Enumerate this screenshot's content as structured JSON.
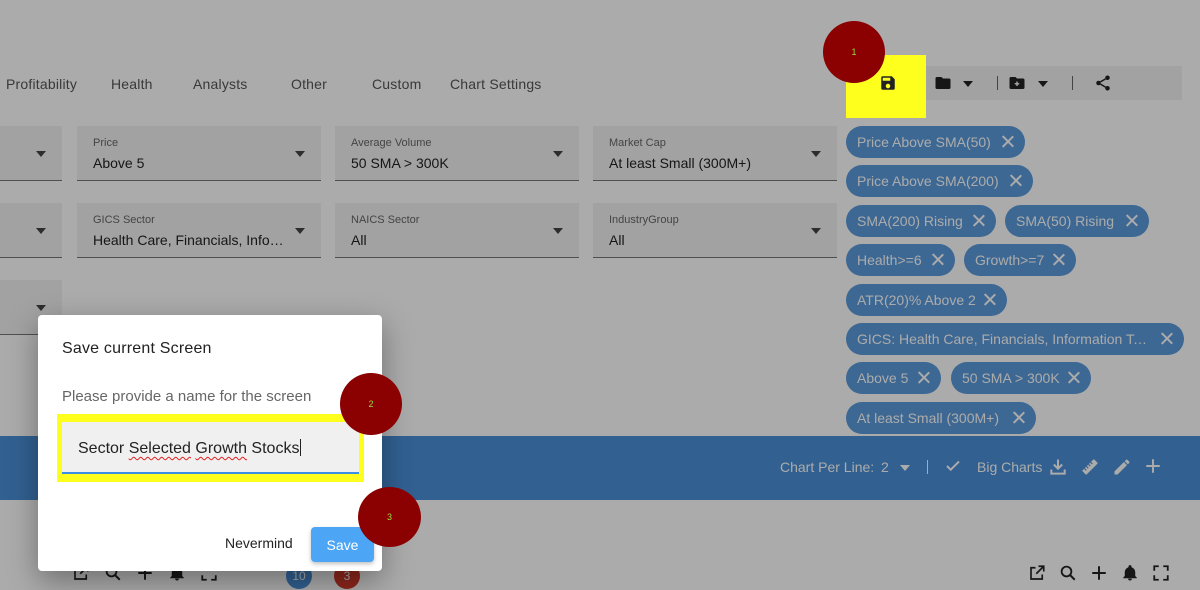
{
  "tabs": [
    "Profitability",
    "Health",
    "Analysts",
    "Other",
    "Custom",
    "Chart Settings"
  ],
  "filters": {
    "price": {
      "label": "Price",
      "value": "Above 5"
    },
    "avg_volume": {
      "label": "Average Volume",
      "value": "50 SMA > 300K"
    },
    "market_cap": {
      "label": "Market Cap",
      "value": "At least Small (300M+)"
    },
    "gics": {
      "label": "GICS Sector",
      "value": "Health Care, Financials, Information Technology"
    },
    "naics": {
      "label": "NAICS Sector",
      "value": "All"
    },
    "industry_group": {
      "label": "IndustryGroup",
      "value": "All"
    }
  },
  "chips": [
    "Price Above SMA(50)",
    "Price Above SMA(200)",
    "SMA(200) Rising",
    "SMA(50) Rising",
    "Health>=6",
    "Growth>=7",
    "ATR(20)% Above 2",
    "GICS: Health Care, Financials, Information Technology",
    "Above 5",
    "50 SMA > 300K",
    "At least Small (300M+)"
  ],
  "chart_bar": {
    "per_line_label": "Chart Per Line:",
    "per_line_value": "2",
    "big_charts_label": "Big Charts"
  },
  "badges": [
    "10",
    "3"
  ],
  "dialog": {
    "title": "Save current Screen",
    "prompt": "Please provide a name for the screen",
    "input_value_before": "Sector ",
    "input_value_misspelled_1": "Selected",
    "input_value_mid": " ",
    "input_value_misspelled_2": "Growth",
    "input_value_after": " Stocks",
    "cancel_label": "Nevermind",
    "save_label": "Save"
  },
  "steps": [
    "1",
    "2",
    "3"
  ],
  "colors": {
    "chip": "#5b9bdb",
    "bar": "#4a90d9",
    "save_button": "#4da6f5",
    "highlight": "#ffff1e",
    "step_marker": "#8b0000",
    "badge_blue": "#4a90d9",
    "badge_red": "#d23a2a"
  },
  "icons": [
    "save-icon",
    "folder-icon",
    "folder-plus-icon",
    "share-icon",
    "check-icon",
    "download-icon",
    "ruler-icon",
    "pencil-icon",
    "plus-icon",
    "external-link-icon",
    "search-icon",
    "bell-icon",
    "fullscreen-icon"
  ]
}
